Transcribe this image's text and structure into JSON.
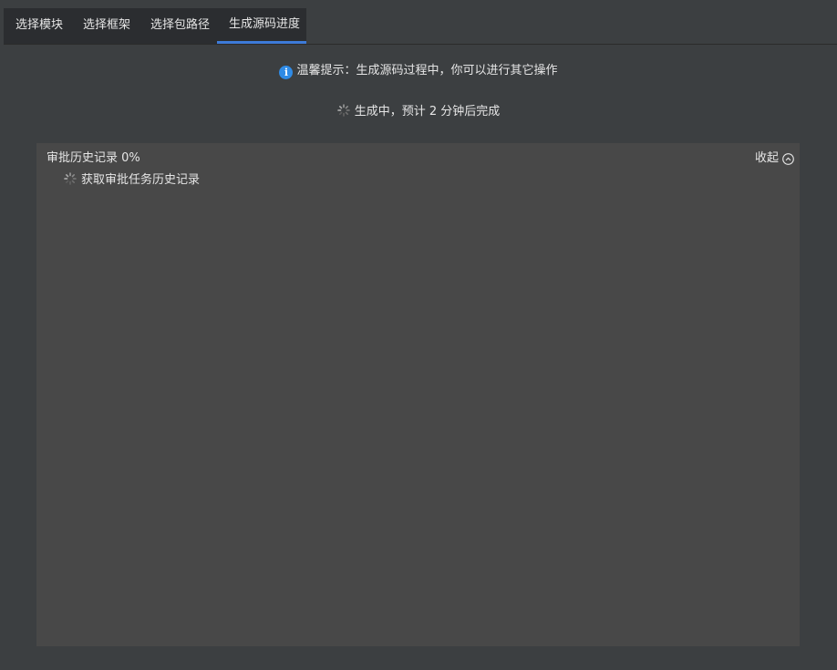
{
  "tabs": [
    {
      "label": "选择模块",
      "active": false
    },
    {
      "label": "选择框架",
      "active": false
    },
    {
      "label": "选择包路径",
      "active": false
    },
    {
      "label": "生成源码进度",
      "active": true
    }
  ],
  "tip": {
    "icon": "info-icon",
    "icon_glyph": "i",
    "text": "温馨提示：生成源码过程中，你可以进行其它操作"
  },
  "status": {
    "icon": "loading-spinner-icon",
    "text": "生成中，预计 2 分钟后完成"
  },
  "panel": {
    "title": "审批历史记录 0%",
    "progress_percent": 0,
    "collapse_label": "收起",
    "collapse_icon": "chevron-up-circle-icon",
    "items": [
      {
        "icon": "loading-spinner-icon",
        "label": "获取审批任务历史记录"
      }
    ]
  },
  "colors": {
    "background": "#3c3f41",
    "tab_bar": "#2b2d30",
    "active_tab_underline": "#3d7bd9",
    "info_icon": "#2f8be6",
    "panel": "#484848"
  }
}
